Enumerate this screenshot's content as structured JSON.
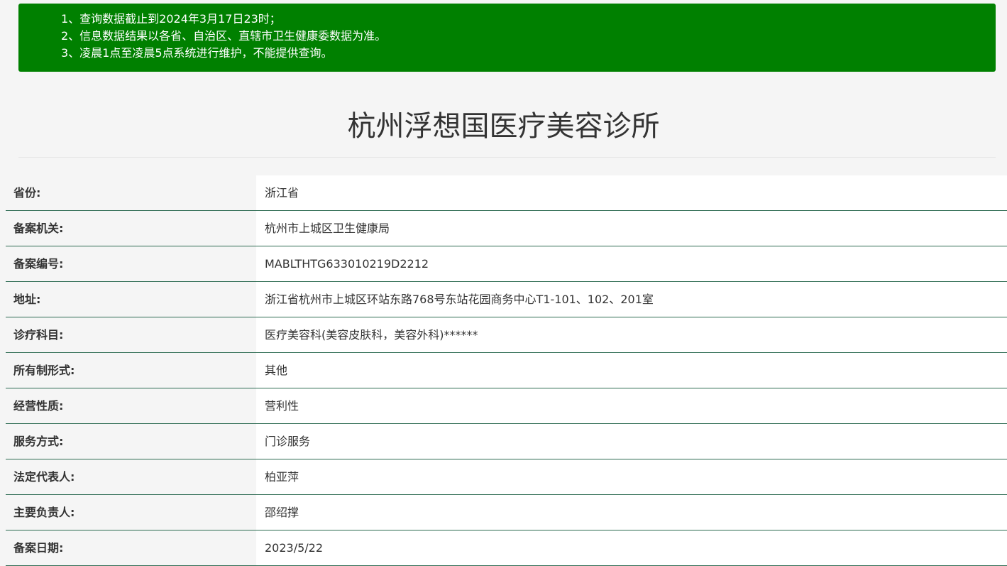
{
  "notice": {
    "lines": [
      "1、查询数据截止到2024年3月17日23时；",
      "2、信息数据结果以各省、自治区、直辖市卫生健康委数据为准。",
      "3、凌晨1点至凌晨5点系统进行维护，不能提供查询。"
    ]
  },
  "title": "杭州浮想国医疗美容诊所",
  "rows": [
    {
      "label": "省份:",
      "value": "浙江省"
    },
    {
      "label": "备案机关:",
      "value": "杭州市上城区卫生健康局"
    },
    {
      "label": "备案编号:",
      "value": "MABLTHTG633010219D2212"
    },
    {
      "label": "地址:",
      "value": "浙江省杭州市上城区环站东路768号东站花园商务中心T1-101、102、201室"
    },
    {
      "label": "诊疗科目:",
      "value": "医疗美容科(美容皮肤科，美容外科)******"
    },
    {
      "label": "所有制形式:",
      "value": "其他"
    },
    {
      "label": "经营性质:",
      "value": "营利性"
    },
    {
      "label": "服务方式:",
      "value": "门诊服务"
    },
    {
      "label": "法定代表人:",
      "value": "柏亚萍"
    },
    {
      "label": "主要负责人:",
      "value": "邵绍撑"
    },
    {
      "label": "备案日期:",
      "value": "2023/5/22"
    }
  ],
  "colors": {
    "notice_bg": "#008000",
    "row_divider": "#2d6b52",
    "page_bg": "#f5f5f5"
  }
}
